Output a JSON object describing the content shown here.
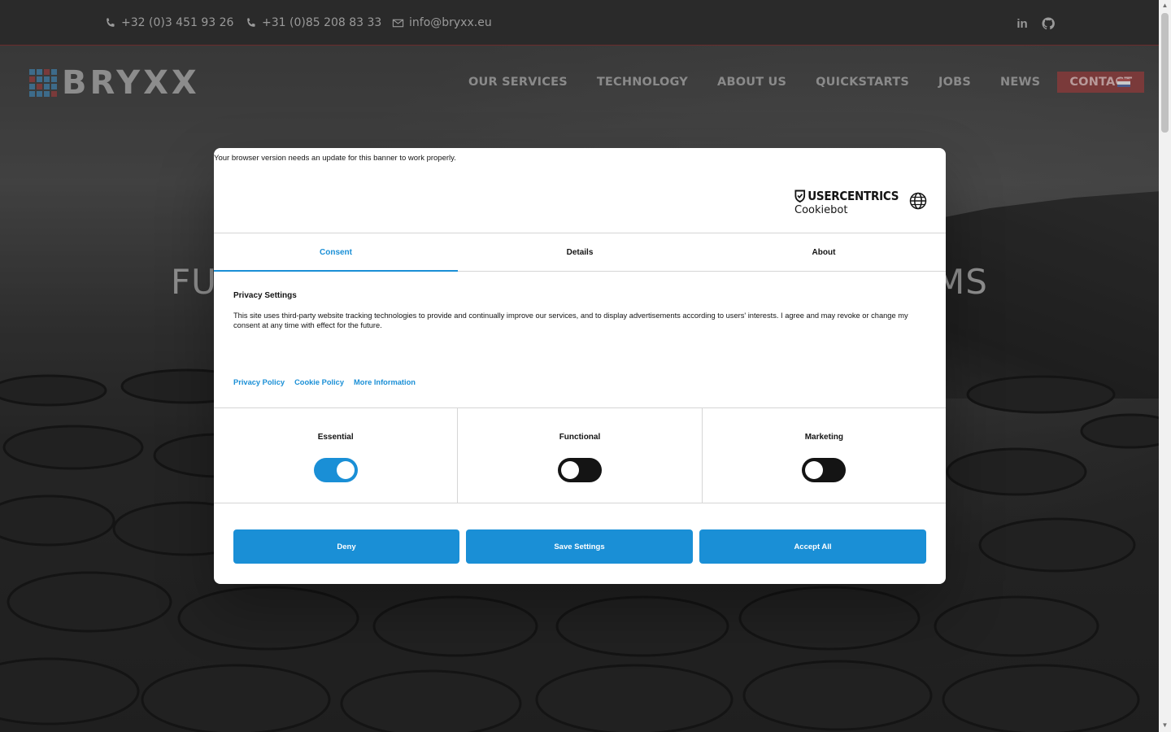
{
  "site": {
    "phone_be": "+32 (0)3 451 93 26",
    "phone_nl": "+31 (0)85 208 83 33",
    "email": "info@bryxx.eu",
    "social": [
      {
        "icon": "linkedin-icon",
        "label": "in"
      },
      {
        "icon": "github-icon",
        "label": ""
      }
    ],
    "logo_text": "BRYXX",
    "nav": [
      "OUR SERVICES",
      "TECHNOLOGY",
      "ABOUT US",
      "QUICKSTARTS",
      "JOBS",
      "NEWS"
    ],
    "nav_contact": "CONTACT",
    "hero_title_left": "FU",
    "hero_title_right": "MS"
  },
  "dialog": {
    "browser_note": "Your browser version needs an update for this banner to work properly.",
    "brand_name": "USERCENTRICS",
    "brand_product": "Cookiebot",
    "tabs": [
      "Consent",
      "Details",
      "About"
    ],
    "active_tab": "Consent",
    "heading": "Privacy Settings",
    "body": "This site uses third-party website tracking technologies to provide and continually improve our services, and to display advertisements according to users' interests. I agree and may revoke or change my consent at any time with effect for the future.",
    "links": [
      "Privacy Policy",
      "Cookie Policy",
      "More Information"
    ],
    "categories": [
      {
        "label": "Essential",
        "enabled": true
      },
      {
        "label": "Functional",
        "enabled": false
      },
      {
        "label": "Marketing",
        "enabled": false
      }
    ],
    "buttons": {
      "deny": "Deny",
      "save": "Save Settings",
      "accept": "Accept All"
    }
  },
  "colors": {
    "accent": "#1a8fd6",
    "toggle_off": "#141414",
    "contact_bg": "#7a3a3a"
  }
}
